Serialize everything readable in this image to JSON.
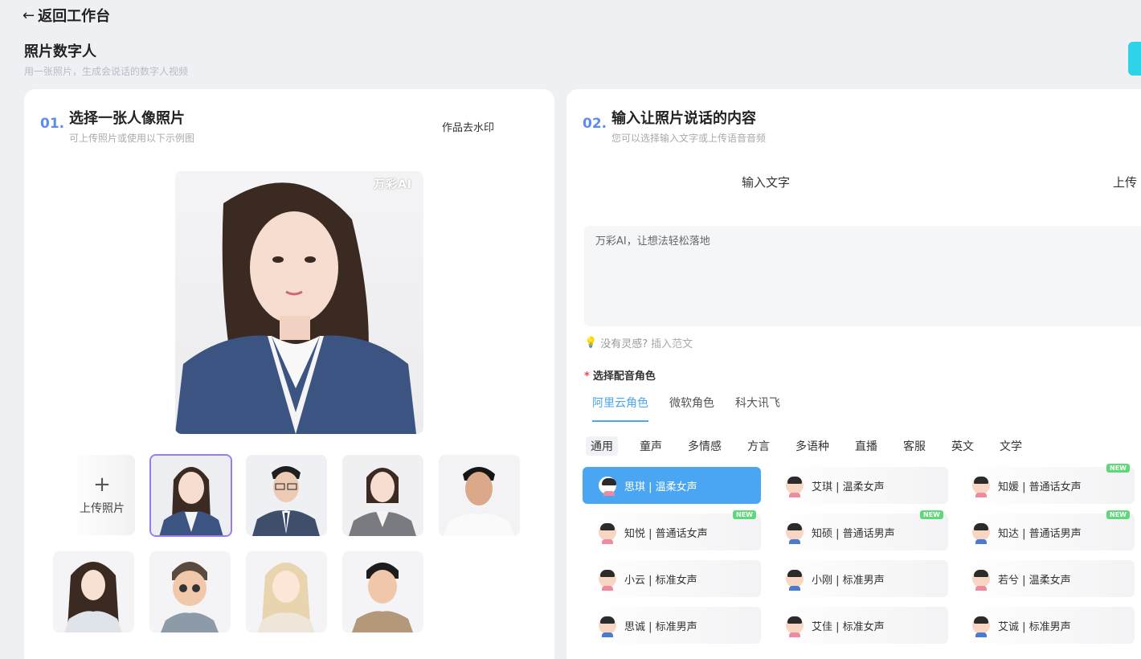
{
  "header": {
    "back_label": "返回工作台",
    "title": "照片数字人",
    "subtitle": "用一张照片，生成会说话的数字人视频"
  },
  "left_card": {
    "step_num": "01.",
    "title": "选择一张人像照片",
    "subtitle": "可上传照片或使用以下示例图",
    "watermark_link": "作品去水印",
    "brand_mark": "万彩AI",
    "upload_plus": "+",
    "upload_label": "上传照片"
  },
  "right_card": {
    "step_num": "02.",
    "title": "输入让照片说话的内容",
    "subtitle": "您可以选择输入文字或上传语音音频",
    "mode_tabs": [
      "输入文字",
      "上传"
    ],
    "text_value": "万彩AI，让想法轻松落地",
    "hint_text": "没有灵感?",
    "hint_link": "插入范文",
    "voice_label": "选择配音角色",
    "provider_tabs": [
      "阿里云角色",
      "微软角色",
      "科大讯飞"
    ],
    "category_tabs": [
      "通用",
      "童声",
      "多情感",
      "方言",
      "多语种",
      "直播",
      "客服",
      "英文",
      "文学"
    ],
    "voices": [
      {
        "label": "思琪 | 温柔女声",
        "gender": "female",
        "new": ""
      },
      {
        "label": "艾琪 | 温柔女声",
        "gender": "female",
        "new": ""
      },
      {
        "label": "知媛 | 普通话女声",
        "gender": "female",
        "new": "NEW"
      },
      {
        "label": "知悦 | 普通话女声",
        "gender": "female",
        "new": "NEW"
      },
      {
        "label": "知硕 | 普通话男声",
        "gender": "male",
        "new": "NEW"
      },
      {
        "label": "知达 | 普通话男声",
        "gender": "male",
        "new": "NEW"
      },
      {
        "label": "小云 | 标准女声",
        "gender": "female",
        "new": ""
      },
      {
        "label": "小刚 | 标准男声",
        "gender": "male",
        "new": ""
      },
      {
        "label": "若兮 | 温柔女声",
        "gender": "female",
        "new": ""
      },
      {
        "label": "思诚 | 标准男声",
        "gender": "male",
        "new": ""
      },
      {
        "label": "艾佳 | 标准女声",
        "gender": "female",
        "new": ""
      },
      {
        "label": "艾诚 | 标准男声",
        "gender": "male",
        "new": ""
      }
    ]
  },
  "colors": {
    "accent": "#4aa6f2",
    "step": "#5b8def",
    "new_badge": "#5fd87a"
  }
}
